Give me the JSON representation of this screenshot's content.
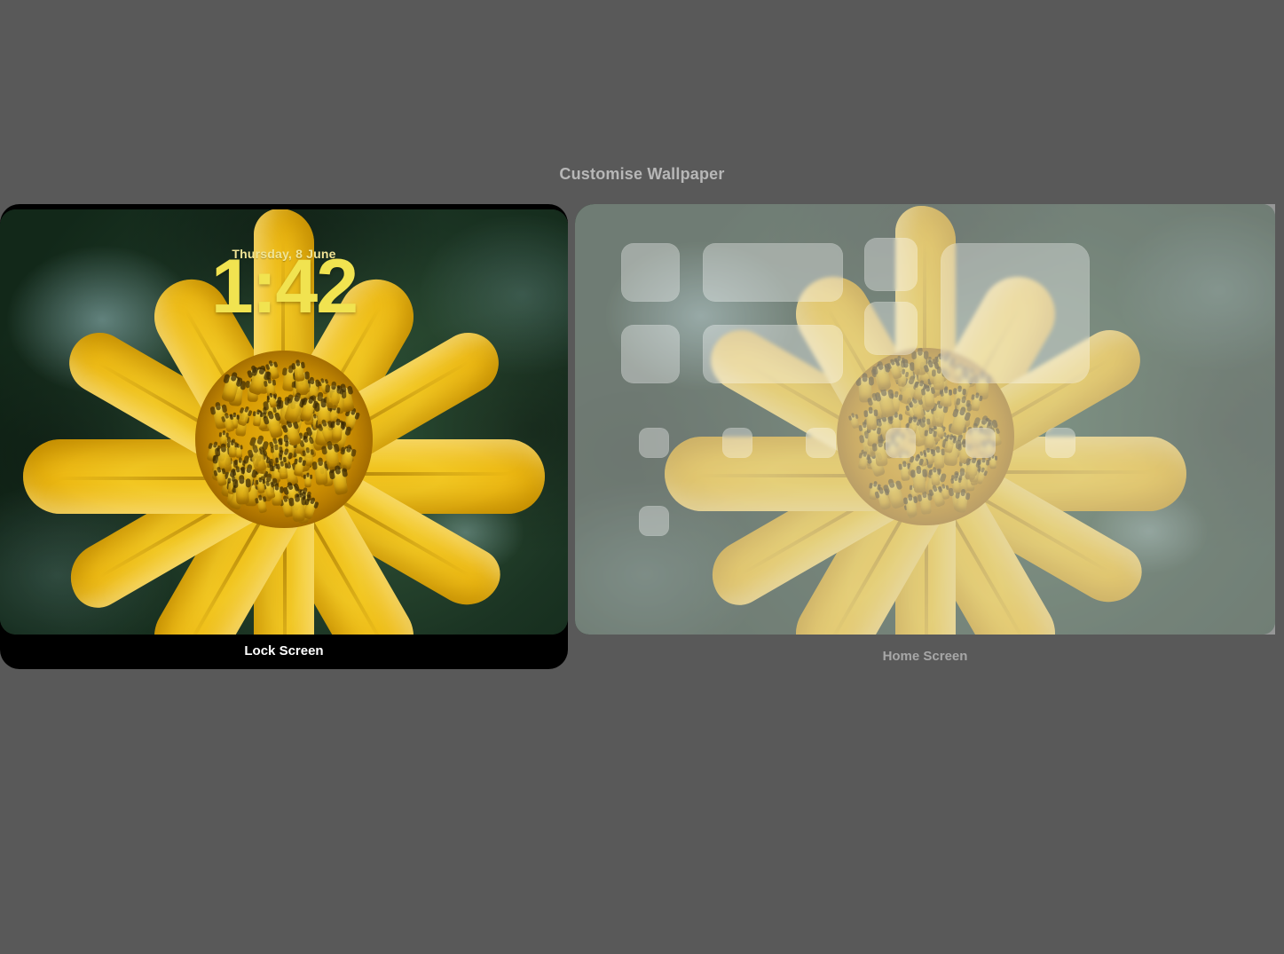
{
  "title": "Customise Wallpaper",
  "lock_screen": {
    "date": "Thursday, 8 June",
    "time": "1:42",
    "label": "Lock Screen"
  },
  "home_screen": {
    "label": "Home Screen"
  }
}
